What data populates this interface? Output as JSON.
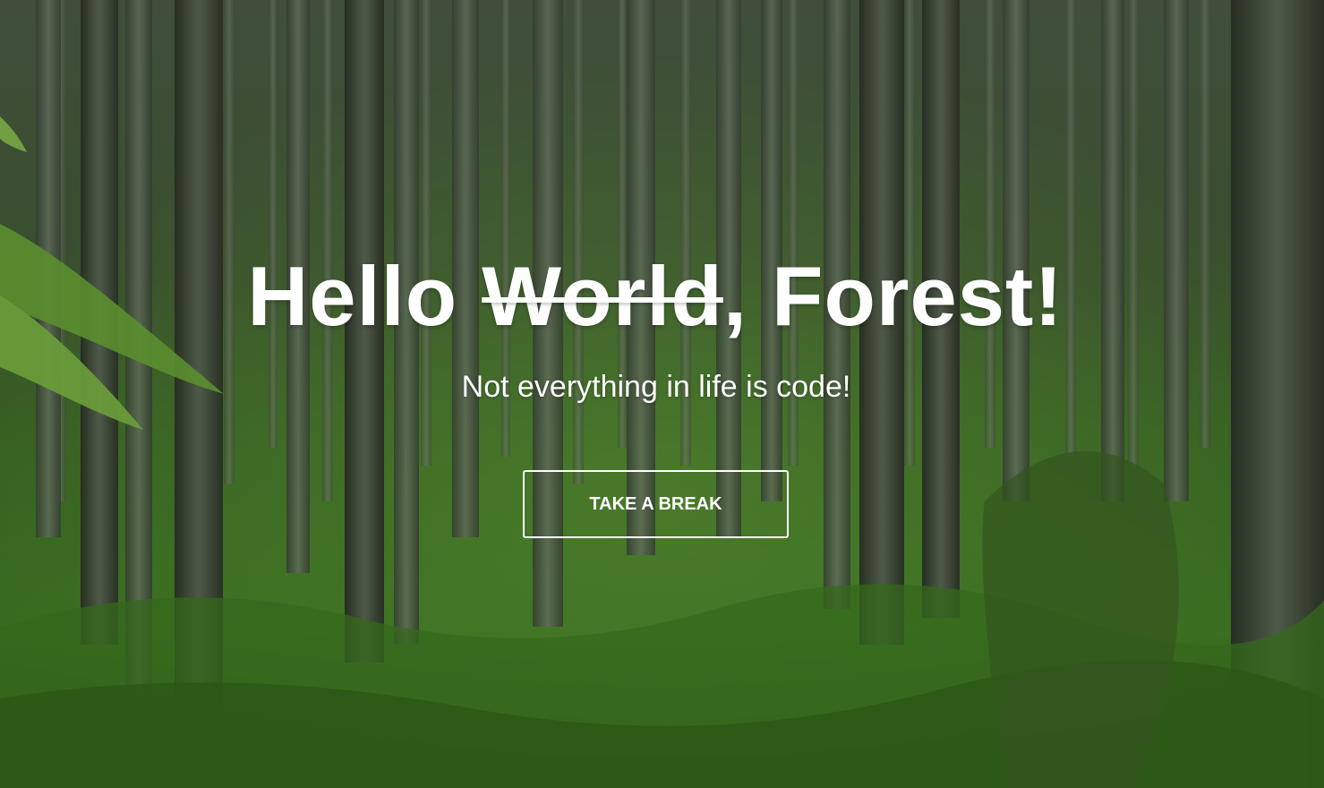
{
  "hero": {
    "headline_start": "Hello ",
    "headline_struck": "World",
    "headline_end": ", Forest!",
    "subtitle": "Not everything in life is code!",
    "button_label": "TAKE A BREAK"
  },
  "colors": {
    "text": "#ffffff",
    "forest_dark": "#2f3f28",
    "moss_green": "#3f7a22"
  }
}
